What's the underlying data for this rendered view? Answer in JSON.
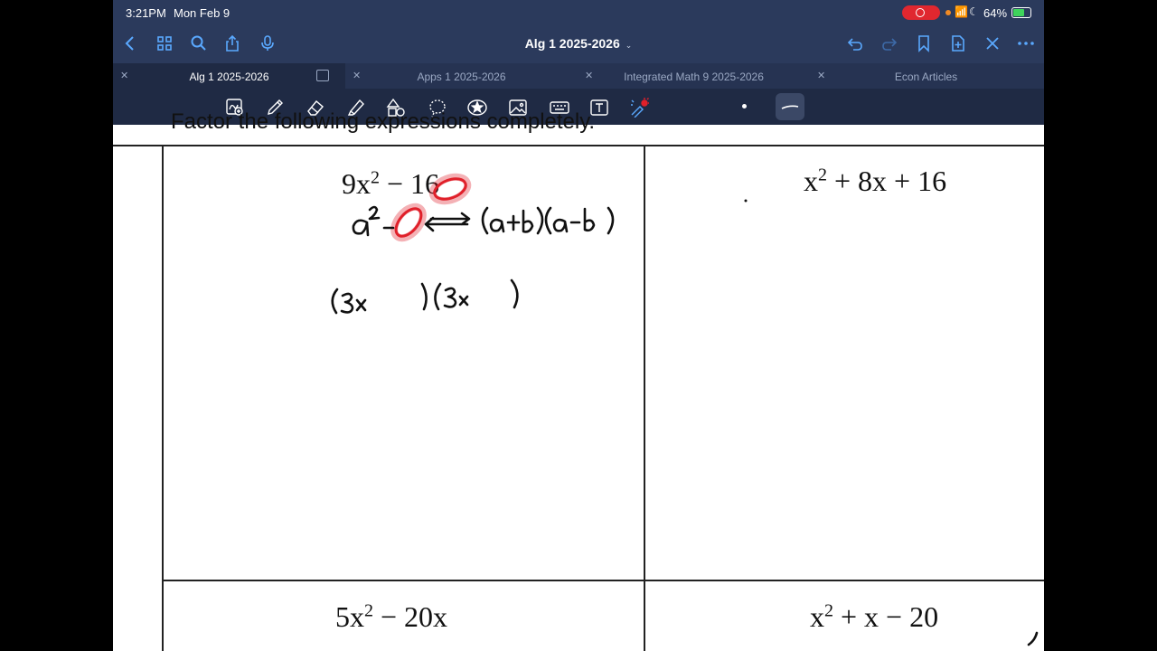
{
  "status_bar": {
    "time": "3:21PM",
    "date": "Mon Feb 9",
    "battery": "64%"
  },
  "nav": {
    "doc_title": "Alg 1 2025-2026",
    "icons": [
      "back-icon",
      "grid-icon",
      "search-icon",
      "share-icon",
      "mic-icon",
      "undo-icon",
      "redo-icon",
      "bookmark-icon",
      "add-page-icon",
      "close-icon",
      "more-icon"
    ]
  },
  "tabs": [
    {
      "label": "Alg 1 2025-2026",
      "active": true
    },
    {
      "label": "Apps 1 2025-2026",
      "active": false
    },
    {
      "label": "Integrated Math 9 2025-2026",
      "active": false
    },
    {
      "label": "Econ Articles",
      "active": false
    }
  ],
  "toolbar": {
    "tools": [
      "lasso-ocr-icon",
      "pen-icon",
      "eraser-icon",
      "highlighter-icon",
      "shapes-icon",
      "lasso-icon",
      "sticker-icon",
      "image-icon",
      "keyboard-icon",
      "text-icon",
      "laser-pointer-icon"
    ]
  },
  "worksheet": {
    "heading": "Factor the following expressions completely.",
    "problems": [
      {
        "base": "9x",
        "exp": "2",
        "rest": " − 16"
      },
      {
        "base": "x",
        "exp": "2",
        "rest": " + 8x + 16"
      },
      {
        "base": "5x",
        "exp": "2",
        "rest": " − 20x"
      },
      {
        "base": "x",
        "exp": "2",
        "rest": " + x − 20"
      }
    ]
  },
  "colors": {
    "nav_bg": "#2b3a5c",
    "accent": "#5aa9ff",
    "laser": "#e0202a",
    "record": "#e0272f"
  }
}
